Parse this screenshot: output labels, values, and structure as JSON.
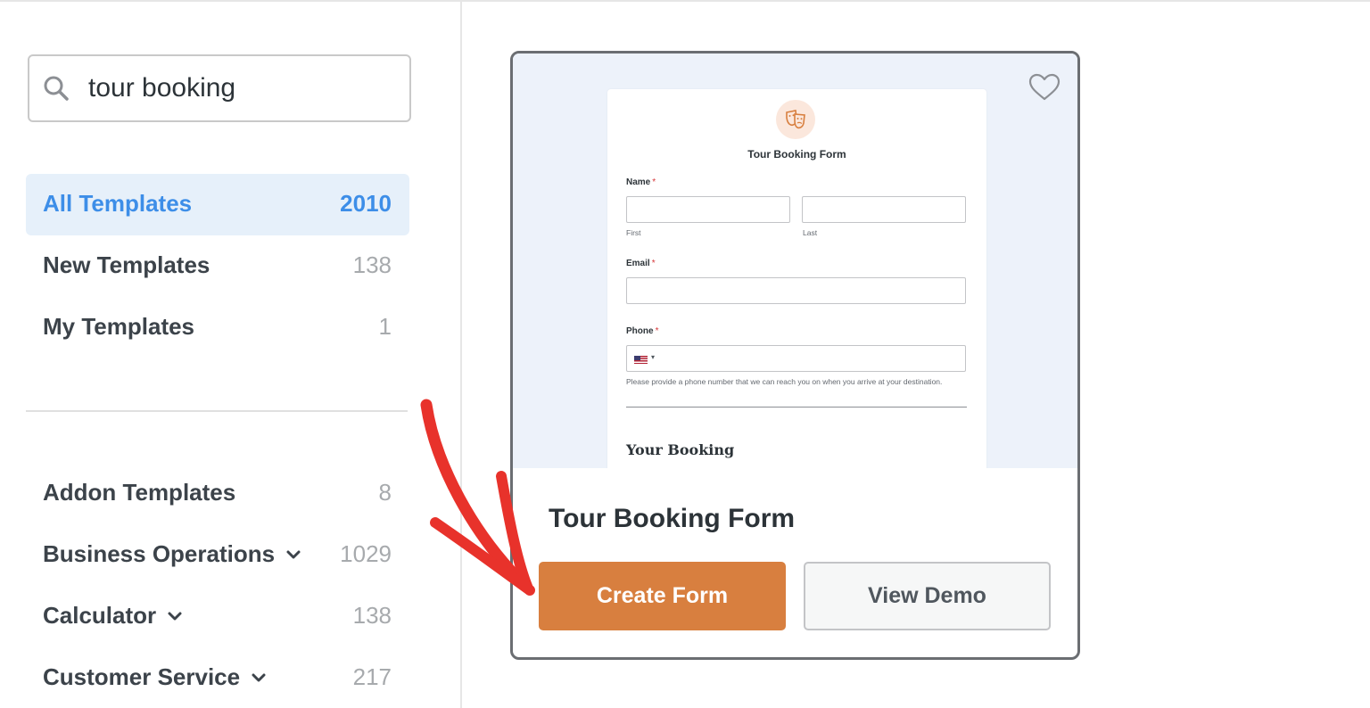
{
  "search": {
    "value": "tour booking",
    "icon": "search-icon"
  },
  "nav": {
    "primary": [
      {
        "label": "All Templates",
        "count": "2010",
        "active": true
      },
      {
        "label": "New Templates",
        "count": "138"
      },
      {
        "label": "My Templates",
        "count": "1"
      }
    ],
    "categories": [
      {
        "label": "Addon Templates",
        "count": "8",
        "expandable": false
      },
      {
        "label": "Business Operations",
        "count": "1029",
        "expandable": true
      },
      {
        "label": "Calculator",
        "count": "138",
        "expandable": true
      },
      {
        "label": "Customer Service",
        "count": "217",
        "expandable": true
      }
    ]
  },
  "card": {
    "title": "Tour Booking Form",
    "favorite_icon": "heart-icon",
    "create_label": "Create Form",
    "demo_label": "View Demo",
    "preview": {
      "logo_icon": "theater-masks-icon",
      "form_title": "Tour Booking Form",
      "name_label": "Name",
      "required_mark": "*",
      "first_sublabel": "First",
      "last_sublabel": "Last",
      "email_label": "Email",
      "phone_label": "Phone",
      "phone_flag": "us-flag-icon",
      "phone_help": "Please provide a phone number that we can reach you on when you arrive at your destination.",
      "section_title": "Your Booking"
    }
  },
  "colors": {
    "accent_blue": "#3d8ee8",
    "active_bg": "#e6f0fa",
    "create_button": "#d87f3f",
    "annotation_arrow": "#e8322b"
  }
}
